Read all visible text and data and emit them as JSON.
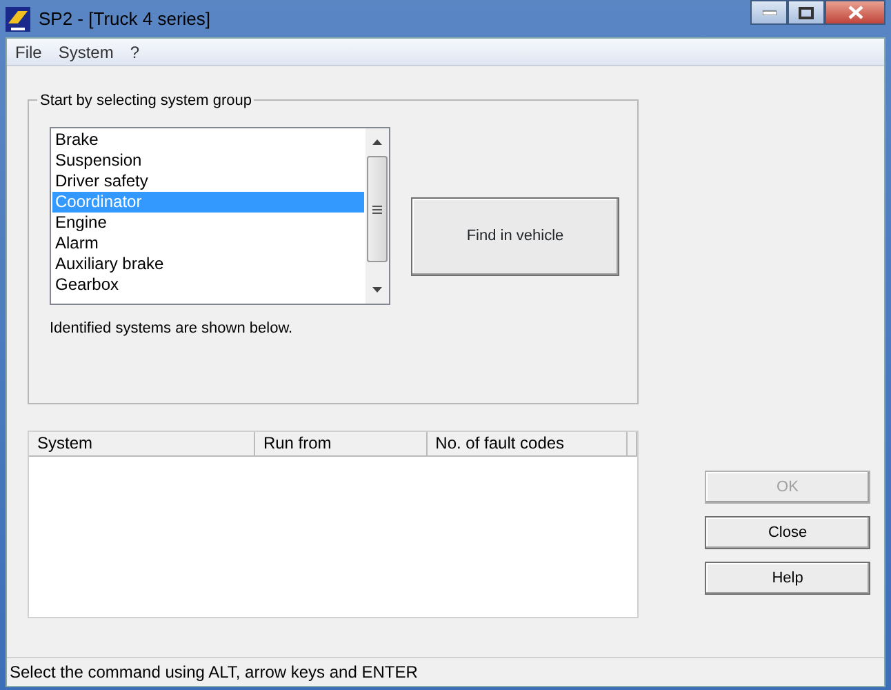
{
  "window": {
    "title": "SP2 - [Truck 4 series]"
  },
  "menu": [
    "File",
    "System",
    "?"
  ],
  "group": {
    "title": "Start by selecting system group",
    "items": [
      {
        "label": "Brake",
        "selected": false
      },
      {
        "label": "Suspension",
        "selected": false
      },
      {
        "label": "Driver safety",
        "selected": false
      },
      {
        "label": "Coordinator",
        "selected": true
      },
      {
        "label": "Engine",
        "selected": false
      },
      {
        "label": "Alarm",
        "selected": false
      },
      {
        "label": "Auxiliary brake",
        "selected": false
      },
      {
        "label": "Gearbox",
        "selected": false
      }
    ],
    "find_button": "Find in vehicle",
    "note": "Identified systems are shown below."
  },
  "table": {
    "columns": [
      "System",
      "Run from",
      "No. of fault codes"
    ]
  },
  "buttons": [
    {
      "label": "OK",
      "disabled": true
    },
    {
      "label": "Close",
      "disabled": false
    },
    {
      "label": "Help",
      "disabled": false
    }
  ],
  "status_bar": "Select the command using ALT, arrow keys and ENTER"
}
